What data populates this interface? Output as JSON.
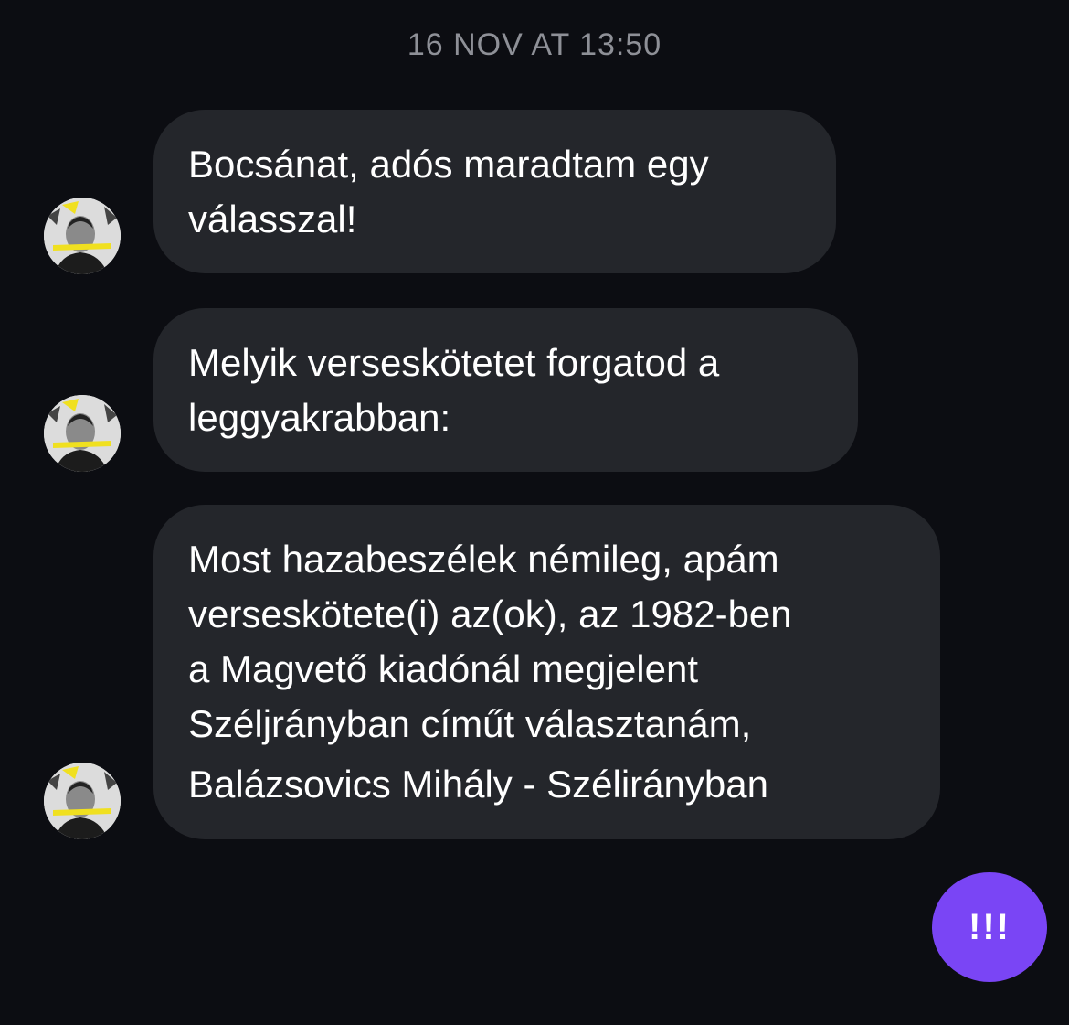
{
  "conversation": {
    "timestamp": "16 NOV AT 13:50",
    "messages": [
      {
        "sender_avatar": "avatar-portrait-icon",
        "lines": [
          "Bocsánat, adós maradtam egy",
          "válasszal!"
        ]
      },
      {
        "sender_avatar": "avatar-portrait-icon",
        "lines": [
          "Melyik verseskötetet forgatod a",
          "leggyakrabban:"
        ]
      },
      {
        "sender_avatar": "avatar-portrait-icon",
        "lines": [
          "Most hazabeszélek némileg, apám",
          "verseskötete(i) az(ok), az 1982-ben",
          "a Magvető kiadónál megjelent",
          "Széljrányban címűt választanám,",
          "Balázsovics Mihály - Szélirányban"
        ]
      }
    ]
  },
  "fab": {
    "label": "!!!",
    "color": "#7a45f5"
  },
  "colors": {
    "background": "#0c0d12",
    "bubble": "#24262b",
    "timestamp": "#8e9097"
  }
}
